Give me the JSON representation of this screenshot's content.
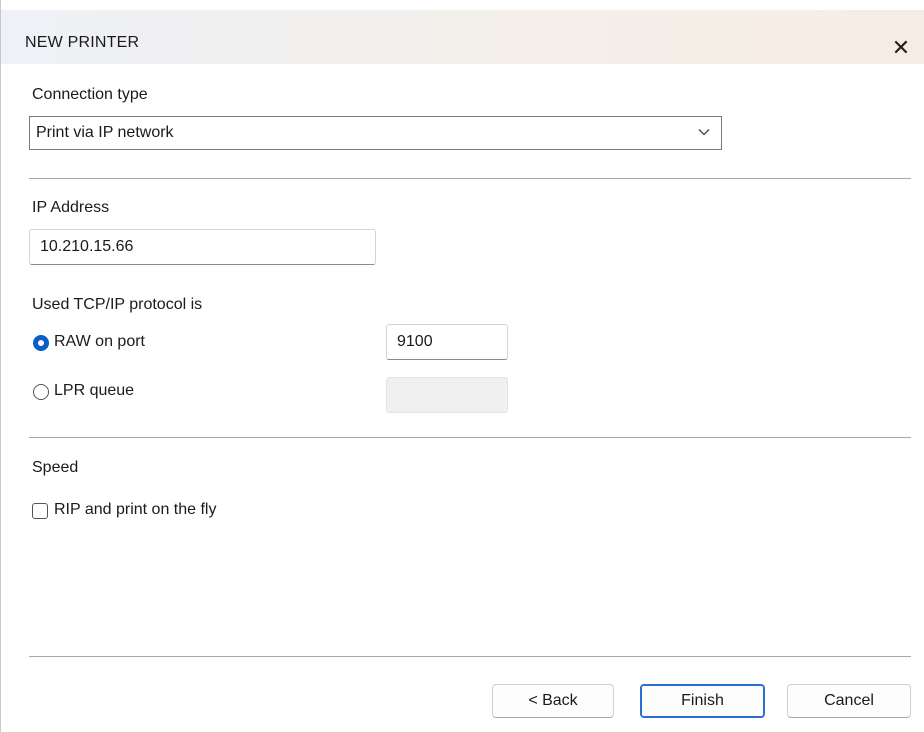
{
  "window": {
    "title": "NEW PRINTER",
    "close_glyph": "✕"
  },
  "connection": {
    "label": "Connection type",
    "selected": "Print via IP network"
  },
  "ip": {
    "label": "IP Address",
    "value": "10.210.15.66"
  },
  "protocol": {
    "label": "Used TCP/IP protocol is",
    "raw_label": "RAW on port",
    "raw_checked": true,
    "raw_port": "9100",
    "lpr_label": "LPR queue",
    "lpr_checked": false,
    "lpr_queue": ""
  },
  "speed": {
    "label": "Speed",
    "rip_label": "RIP and print on the fly",
    "rip_checked": false
  },
  "buttons": {
    "back": "< Back",
    "finish": "Finish",
    "cancel": "Cancel"
  },
  "colors": {
    "accent": "#0a5ec4",
    "primary_border": "#2a6fd0"
  }
}
